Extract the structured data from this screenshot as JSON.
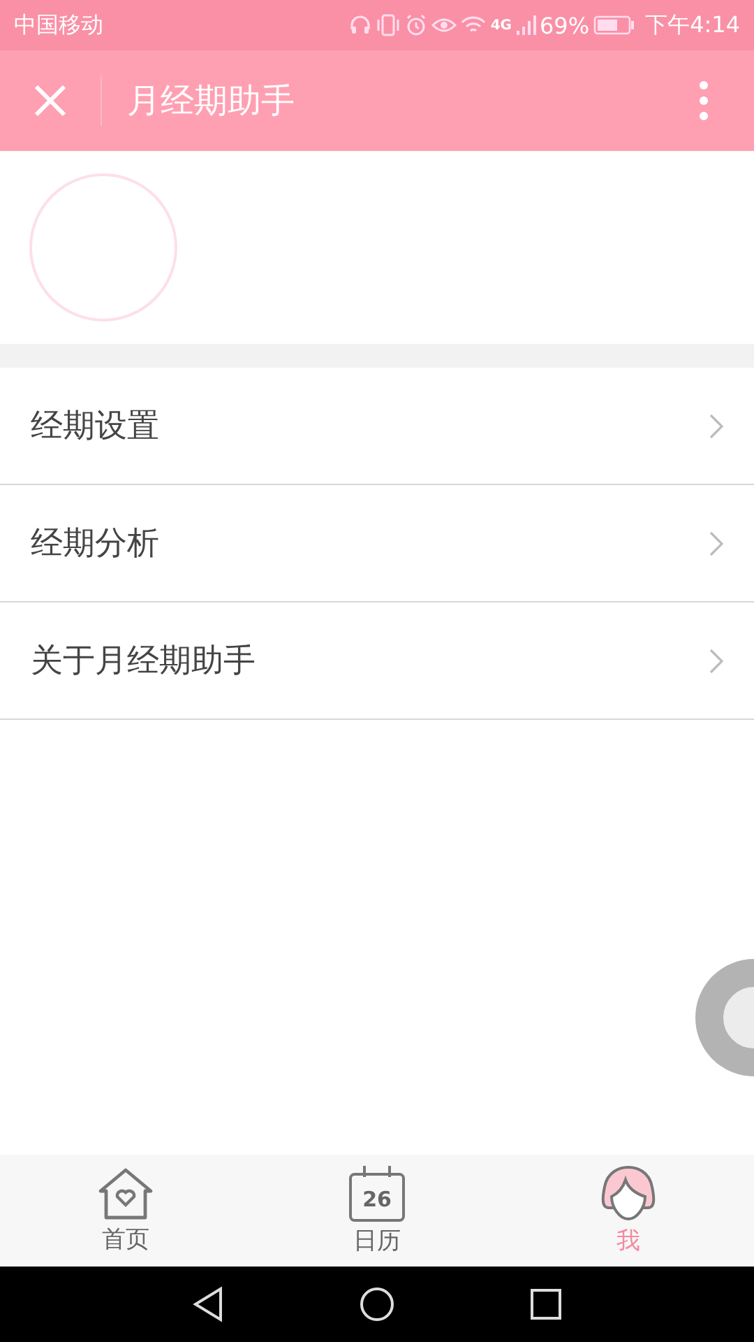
{
  "status_bar": {
    "carrier": "中国移动",
    "network": "4G",
    "battery": "69%",
    "time": "下午4:14"
  },
  "header": {
    "title": "月经期助手"
  },
  "menu": [
    {
      "label": "经期设置"
    },
    {
      "label": "经期分析"
    },
    {
      "label": "关于月经期助手"
    }
  ],
  "tab_bar": [
    {
      "kind": "home",
      "label": "首页",
      "selected": false
    },
    {
      "kind": "calendar",
      "label": "日历",
      "icon_text": "26",
      "selected": false
    },
    {
      "kind": "me",
      "label": "我",
      "selected": true
    }
  ]
}
